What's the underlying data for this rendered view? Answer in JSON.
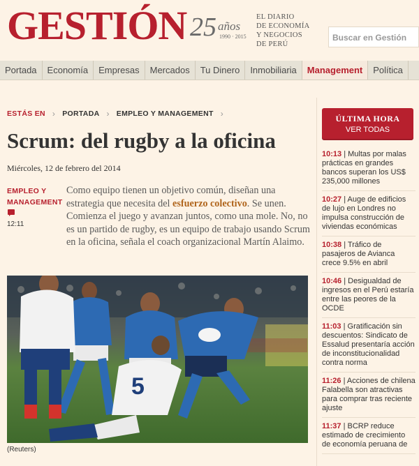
{
  "header": {
    "logo": "GESTIÓN",
    "anniversary": {
      "number": "25",
      "label": "años",
      "years": "1990 · 2015"
    },
    "tagline": [
      "EL DIARIO",
      "DE ECONOMÍA",
      "Y NEGOCIOS",
      "DE PERÚ"
    ],
    "search_placeholder": "Buscar en Gestión"
  },
  "nav": [
    {
      "label": "Portada",
      "active": false
    },
    {
      "label": "Economía",
      "active": false
    },
    {
      "label": "Empresas",
      "active": false
    },
    {
      "label": "Mercados",
      "active": false
    },
    {
      "label": "Tu Dinero",
      "active": false
    },
    {
      "label": "Inmobiliaria",
      "active": false
    },
    {
      "label": "Management",
      "active": true
    },
    {
      "label": "Política",
      "active": false
    }
  ],
  "breadcrumb": {
    "here": "ESTÁS EN",
    "items": [
      "PORTADA",
      "EMPLEO Y MANAGEMENT"
    ]
  },
  "article": {
    "title": "Scrum: del rugby a la oficina",
    "date": "Miércoles, 12 de febrero del 2014",
    "section": "EMPLEO Y MANAGEMENT",
    "time": "12:11",
    "lead_before": "Como equipo tienen un objetivo común, diseñan una estrategia que necesita del ",
    "lead_highlight": "esfuerzo colectivo",
    "lead_after": ". Se unen. Comienza el juego y avanzan juntos, como una mole. No, no es un partido de rugby, es un equipo de trabajo usando Scrum en la oficina, señala el coach organizacional Martín Alaimo.",
    "photo_caption": "(Reuters)"
  },
  "sidebar": {
    "title": "ÚLTIMA HORA",
    "subtitle": "VER TODAS",
    "news": [
      {
        "time": "10:13",
        "text": "Multas por malas prácticas en grandes bancos superan los US$ 235,000 millones"
      },
      {
        "time": "10:27",
        "text": "Auge de edificios de lujo en Londres no impulsa construcción de viviendas económicas"
      },
      {
        "time": "10:38",
        "text": "Tráfico de pasajeros de Avianca crece 9.5% en abril"
      },
      {
        "time": "10:46",
        "text": "Desigualdad de ingresos en el Perú estaría entre las peores de la OCDE"
      },
      {
        "time": "11:03",
        "text": "Gratificación sin descuentos: Sindicato de Essalud presentaría acción de inconstitucionalidad contra norma"
      },
      {
        "time": "11:26",
        "text": "Acciones de chilena Falabella son atractivas para comprar tras reciente ajuste"
      },
      {
        "time": "11:37",
        "text": "BCRP reduce estimado de crecimiento de economía peruana de"
      }
    ]
  },
  "colors": {
    "brand": "#b7202e",
    "background": "#fdf3e6",
    "highlight": "#b0651c"
  }
}
